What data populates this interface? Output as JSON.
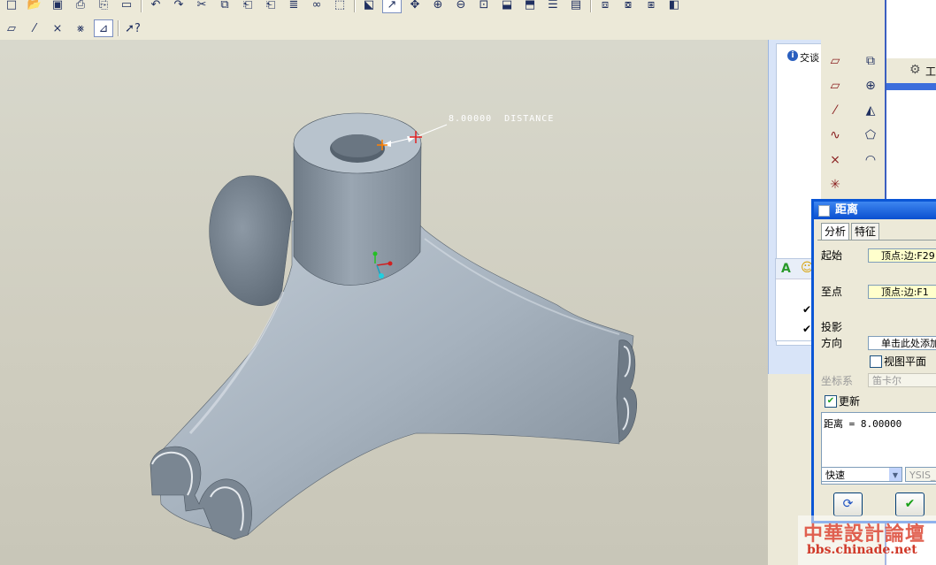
{
  "dimension": {
    "text": "8.00000  DISTANCE"
  },
  "message_panel": {
    "text": "交谈"
  },
  "right_edge": {
    "label": "工"
  },
  "dialog": {
    "title": "距离",
    "tabs": [
      "分析",
      "特征"
    ],
    "from_label": "起始",
    "from_value": "顶点:边:F29",
    "to_label": "至点",
    "to_value": "顶点:边:F1",
    "projection_label": "投影",
    "direction_label": "方向",
    "direction_value": "单击此处添加",
    "view_plane_label": "视图平面",
    "view_plane_checked": false,
    "coord_label": "坐标系",
    "coord_value": "笛卡尔",
    "update_label": "更新",
    "update_checked": true,
    "result_text": "距离 = 8.00000",
    "mode_value": "快速",
    "analysis_value": "YSIS_"
  },
  "watermark": {
    "line1": "中華設計論壇",
    "line2": "bbs.chinade.net"
  },
  "colors": {
    "model": "#8e9aa6",
    "viewport_bg": "#d3d1c5",
    "title_bar": "#0a4fd0"
  }
}
